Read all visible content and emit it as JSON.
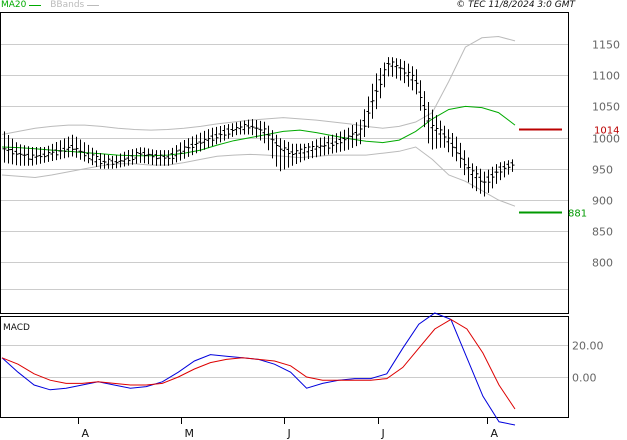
{
  "header": {
    "legend": [
      {
        "label": "MA20",
        "color": "#00aa00"
      },
      {
        "label": "BBands",
        "color": "#bbbbbb"
      }
    ],
    "copyright": "© TEC 11/8/2024 3:0 GMT"
  },
  "indicator_label": "MACD",
  "colors": {
    "ma": "#00aa00",
    "bbands": "#bbbbbb",
    "price": "#000000",
    "macd": "#0000dd",
    "signal": "#dd0000",
    "resistance": "#bb0000",
    "support": "#009900",
    "grid": "#cccccc",
    "axis_text": "#666666",
    "frame": "#000000"
  },
  "chart_data": [
    {
      "type": "ohlc",
      "y_ticks": [
        800,
        850,
        900,
        950,
        1000,
        1050,
        1100,
        1150
      ],
      "ylim": [
        735,
        1200
      ],
      "x_ticks": [
        "A",
        "M",
        "J",
        "J",
        "A"
      ],
      "levels": [
        {
          "label": "1014",
          "value": 1014,
          "color": "resistance"
        },
        {
          "label": "881",
          "value": 881,
          "color": "support"
        }
      ],
      "bbands": {
        "upper": [
          1005,
          1010,
          1015,
          1018,
          1020,
          1020,
          1018,
          1015,
          1013,
          1012,
          1013,
          1015,
          1018,
          1022,
          1025,
          1028,
          1030,
          1032,
          1030,
          1028,
          1025,
          1022,
          1018,
          1015,
          1018,
          1025,
          1040,
          1090,
          1145,
          1160,
          1162,
          1155
        ],
        "lower": [
          940,
          938,
          936,
          940,
          945,
          950,
          955,
          958,
          958,
          956,
          956,
          960,
          965,
          970,
          972,
          973,
          972,
          970,
          968,
          970,
          972,
          972,
          972,
          975,
          978,
          985,
          965,
          940,
          930,
          915,
          900,
          890
        ]
      },
      "ma20": [
        985,
        984,
        982,
        980,
        978,
        976,
        974,
        972,
        971,
        971,
        972,
        975,
        980,
        988,
        995,
        1000,
        1005,
        1010,
        1012,
        1008,
        1003,
        998,
        994,
        992,
        996,
        1010,
        1030,
        1045,
        1050,
        1048,
        1040,
        1020
      ],
      "ohlc_close": [
        982,
        975,
        968,
        972,
        978,
        985,
        972,
        962,
        960,
        965,
        975,
        970,
        968,
        980,
        990,
        998,
        1008,
        1015,
        1018,
        1010,
        985,
        975,
        980,
        985,
        990,
        1000,
        1010,
        1070,
        1120,
        1110,
        1090,
        1020,
        1005,
        978,
        945,
        928,
        948,
        958
      ],
      "ohlc_range": [
        [
          960,
          1010
        ],
        [
          955,
          990
        ],
        [
          955,
          985
        ],
        [
          960,
          985
        ],
        [
          965,
          995
        ],
        [
          970,
          1005
        ],
        [
          960,
          990
        ],
        [
          950,
          975
        ],
        [
          950,
          970
        ],
        [
          955,
          980
        ],
        [
          960,
          985
        ],
        [
          955,
          980
        ],
        [
          955,
          980
        ],
        [
          965,
          995
        ],
        [
          975,
          1005
        ],
        [
          985,
          1015
        ],
        [
          995,
          1020
        ],
        [
          1005,
          1025
        ],
        [
          1005,
          1030
        ],
        [
          990,
          1025
        ],
        [
          945,
          1000
        ],
        [
          955,
          990
        ],
        [
          965,
          990
        ],
        [
          970,
          1000
        ],
        [
          975,
          1005
        ],
        [
          980,
          1015
        ],
        [
          990,
          1030
        ],
        [
          1040,
          1100
        ],
        [
          1100,
          1130
        ],
        [
          1090,
          1125
        ],
        [
          1070,
          1110
        ],
        [
          980,
          1050
        ],
        [
          985,
          1020
        ],
        [
          960,
          1000
        ],
        [
          920,
          960
        ],
        [
          905,
          945
        ],
        [
          930,
          960
        ],
        [
          945,
          965
        ]
      ]
    },
    {
      "type": "line",
      "title": "MACD",
      "y_ticks": [
        0,
        20
      ],
      "ylim": [
        -30,
        40
      ],
      "series": [
        {
          "name": "",
          "color": "macd",
          "values": [
            12,
            3,
            -5,
            -8,
            -7,
            -5,
            -3,
            -5,
            -7,
            -6,
            -3,
            3,
            10,
            14,
            13,
            12,
            11,
            8,
            3,
            -7,
            -4,
            -2,
            -1,
            -1,
            2,
            18,
            33,
            40,
            36,
            12,
            -12,
            -28,
            -30
          ]
        },
        {
          "name": "",
          "color": "signal",
          "values": [
            12,
            8,
            2,
            -2,
            -4,
            -4,
            -3,
            -4,
            -5,
            -5,
            -4,
            0,
            5,
            9,
            11,
            12,
            11,
            10,
            7,
            0,
            -2,
            -2,
            -2,
            -2,
            -1,
            6,
            18,
            30,
            36,
            30,
            15,
            -5,
            -20
          ]
        }
      ]
    }
  ]
}
